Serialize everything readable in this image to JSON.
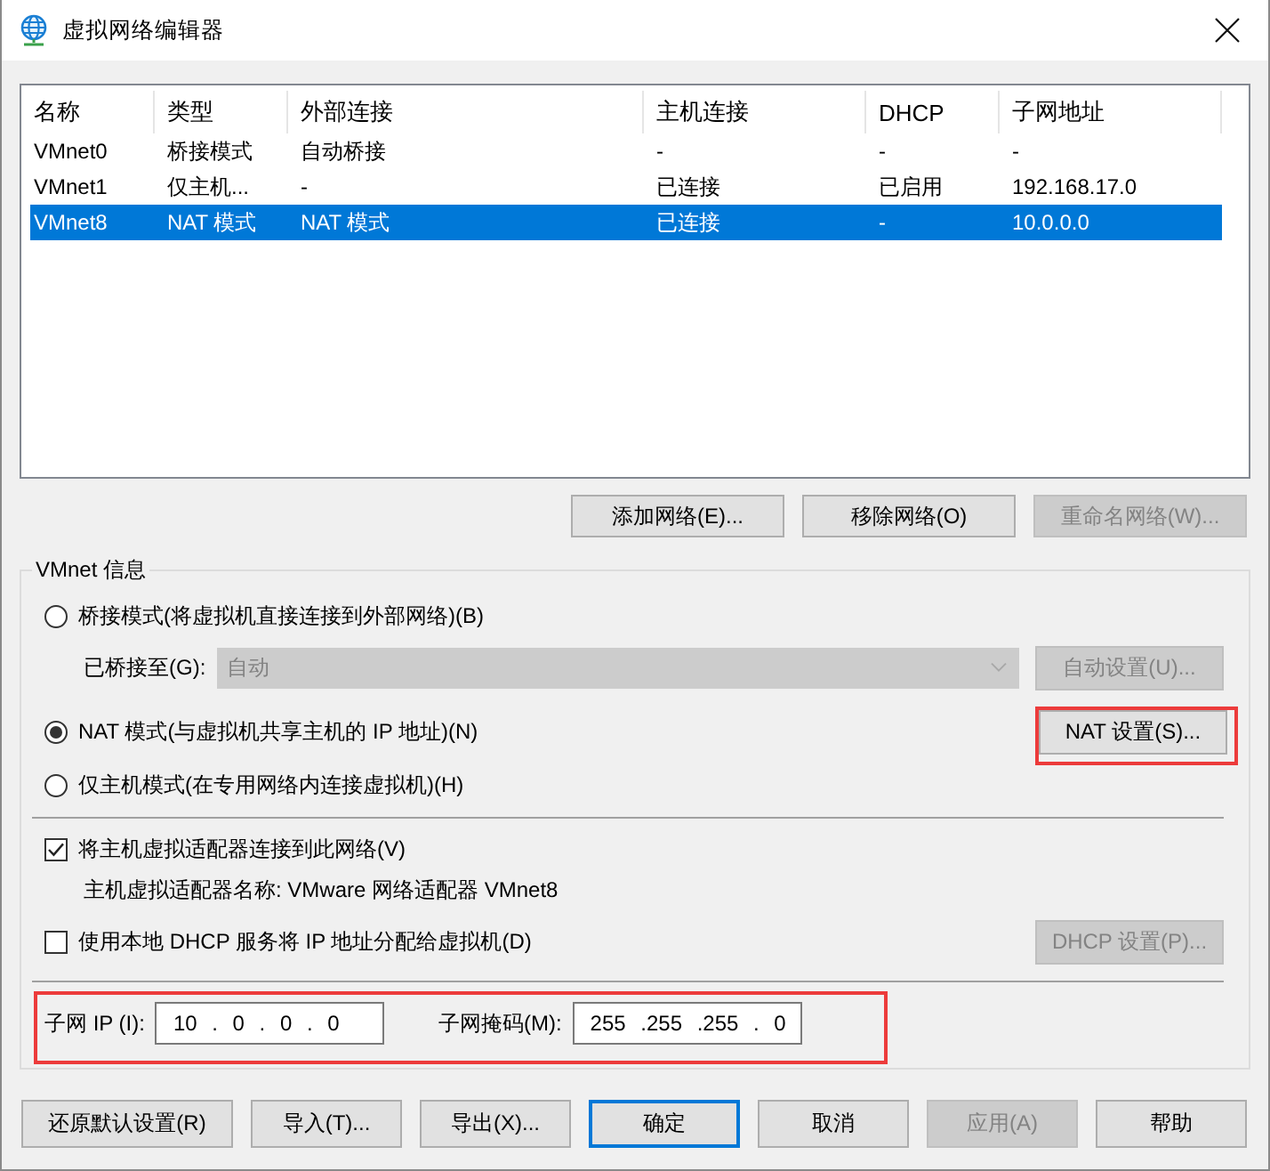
{
  "window": {
    "title": "虚拟网络编辑器"
  },
  "table": {
    "columns": [
      "名称",
      "类型",
      "外部连接",
      "主机连接",
      "DHCP",
      "子网地址"
    ],
    "rows": [
      {
        "cells": [
          "VMnet0",
          "桥接模式",
          "自动桥接",
          "-",
          "-",
          "-"
        ],
        "selected": false
      },
      {
        "cells": [
          "VMnet1",
          "仅主机...",
          "-",
          "已连接",
          "已启用",
          "192.168.17.0"
        ],
        "selected": false
      },
      {
        "cells": [
          "VMnet8",
          "NAT 模式",
          "NAT 模式",
          "已连接",
          "-",
          "10.0.0.0"
        ],
        "selected": true
      }
    ]
  },
  "network_buttons": [
    {
      "label": "添加网络(E)...",
      "disabled": false
    },
    {
      "label": "移除网络(O)",
      "disabled": false
    },
    {
      "label": "重命名网络(W)...",
      "disabled": true
    }
  ],
  "vmnet_info": {
    "title": "VMnet 信息",
    "modes": [
      {
        "label": "桥接模式(将虚拟机直接连接到外部网络)(B)",
        "selected": false
      },
      {
        "label": "NAT 模式(与虚拟机共享主机的 IP 地址)(N)",
        "selected": true
      },
      {
        "label": "仅主机模式(在专用网络内连接虚拟机)(H)",
        "selected": false
      }
    ],
    "bridged_to": {
      "label": "已桥接至(G):",
      "value": "自动",
      "disabled": true
    },
    "auto_settings_button": {
      "label": "自动设置(U)...",
      "disabled": true
    },
    "nat_settings_button": {
      "label": "NAT 设置(S)...",
      "disabled": false,
      "highlighted": true
    },
    "host_adapter": {
      "label": "将主机虚拟适配器连接到此网络(V)",
      "checked": true
    },
    "adapter_name": "主机虚拟适配器名称: VMware 网络适配器 VMnet8",
    "dhcp": {
      "label": "使用本地 DHCP 服务将 IP 地址分配给虚拟机(D)",
      "checked": false
    },
    "dhcp_settings_button": {
      "label": "DHCP 设置(P)...",
      "disabled": true
    },
    "subnet": {
      "highlighted": true,
      "ip_label": "子网 IP (I):",
      "ip_value": "10 . 0 . 0 . 0",
      "mask_label": "子网掩码(M):",
      "mask_value": "255 .255 .255 . 0"
    }
  },
  "footer_buttons": [
    {
      "label": "还原默认设置(R)",
      "disabled": false,
      "default": false
    },
    {
      "label": "导入(T)...",
      "disabled": false,
      "default": false
    },
    {
      "label": "导出(X)...",
      "disabled": false,
      "default": false
    },
    {
      "label": "确定",
      "disabled": false,
      "default": true
    },
    {
      "label": "取消",
      "disabled": false,
      "default": false
    },
    {
      "label": "应用(A)",
      "disabled": true,
      "default": false
    },
    {
      "label": "帮助",
      "disabled": false,
      "default": false
    }
  ]
}
